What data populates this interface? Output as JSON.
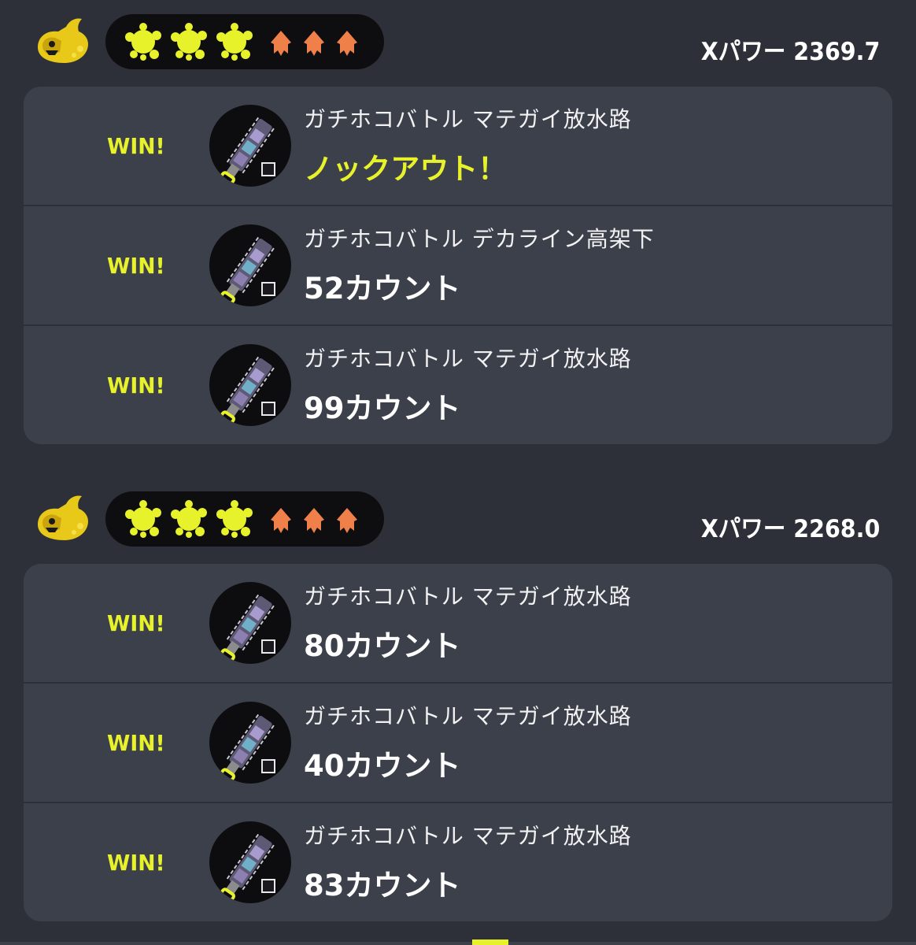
{
  "colors": {
    "background": "#2d3038",
    "card": "#3c404b",
    "win": "#e8f22a",
    "splat": "#e8f22a",
    "squid": "#f0804a",
    "text": "#ffffff"
  },
  "groups": [
    {
      "mode_icon": "rainmaker-icon",
      "splat_count": 3,
      "squid_count": 3,
      "xpower": "Xパワー 2369.7",
      "matches": [
        {
          "result": "WIN!",
          "mode_stage": "ガチホコバトル マテガイ放水路",
          "outcome": "ノックアウト！",
          "knockout": true,
          "weapon_icon": "weapon-icon"
        },
        {
          "result": "WIN!",
          "mode_stage": "ガチホコバトル デカライン高架下",
          "outcome": "52カウント",
          "knockout": false,
          "weapon_icon": "weapon-icon"
        },
        {
          "result": "WIN!",
          "mode_stage": "ガチホコバトル マテガイ放水路",
          "outcome": "99カウント",
          "knockout": false,
          "weapon_icon": "weapon-icon"
        }
      ]
    },
    {
      "mode_icon": "rainmaker-icon",
      "splat_count": 3,
      "squid_count": 3,
      "xpower": "Xパワー 2268.0",
      "matches": [
        {
          "result": "WIN!",
          "mode_stage": "ガチホコバトル マテガイ放水路",
          "outcome": "80カウント",
          "knockout": false,
          "weapon_icon": "weapon-icon"
        },
        {
          "result": "WIN!",
          "mode_stage": "ガチホコバトル マテガイ放水路",
          "outcome": "40カウント",
          "knockout": false,
          "weapon_icon": "weapon-icon"
        },
        {
          "result": "WIN!",
          "mode_stage": "ガチホコバトル マテガイ放水路",
          "outcome": "83カウント",
          "knockout": false,
          "weapon_icon": "weapon-icon"
        }
      ]
    }
  ]
}
